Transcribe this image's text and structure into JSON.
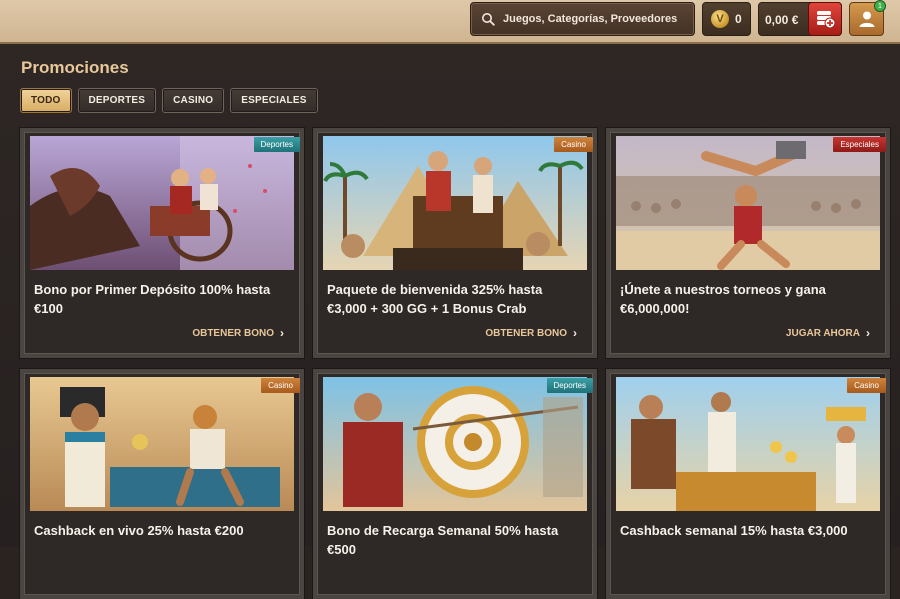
{
  "header": {
    "search_placeholder": "Juegos, Categorías, Proveedores",
    "coin_symbol": "V",
    "coins_value": "0",
    "balance": "0,00 €",
    "notification_count": "1"
  },
  "page": {
    "title": "Promociones",
    "filters": [
      {
        "label": "TODO",
        "active": true
      },
      {
        "label": "DEPORTES",
        "active": false
      },
      {
        "label": "CASINO",
        "active": false
      },
      {
        "label": "ESPECIALES",
        "active": false
      }
    ]
  },
  "promotions": [
    {
      "tag": "Deportes",
      "title": "Bono por Primer Depósito 100% hasta €100",
      "cta": "OBTENER BONO"
    },
    {
      "tag": "Casino",
      "title": "Paquete de bienvenida 325% hasta €3,000 + 300 GG + 1 Bonus Crab",
      "cta": "OBTENER BONO"
    },
    {
      "tag": "Especiales",
      "title": "¡Únete a nuestros torneos y gana €6,000,000!",
      "cta": "JUGAR AHORA"
    },
    {
      "tag": "Casino",
      "title": "Cashback en vivo 25% hasta €200",
      "cta": ""
    },
    {
      "tag": "Deportes",
      "title": "Bono de Recarga Semanal 50% hasta €500",
      "cta": ""
    },
    {
      "tag": "Casino",
      "title": "Cashback semanal 15% hasta €3,000",
      "cta": ""
    }
  ],
  "icons": {
    "search": "search-icon",
    "coin": "coin-icon",
    "deposit": "deposit-icon",
    "user": "user-icon",
    "chevron": "chevron-right-icon"
  },
  "colors": {
    "accent_gold": "#e8c79a",
    "tag_deportes": "#2c8990",
    "tag_casino": "#bf6e2c",
    "tag_especiales": "#b12a25",
    "deposit_red": "#c93127"
  }
}
